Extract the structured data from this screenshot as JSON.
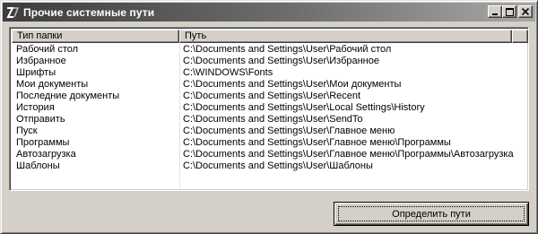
{
  "window": {
    "title": "Прочие системные пути",
    "icon": "app-icon-z",
    "buttons": [
      "minimize",
      "maximize",
      "close"
    ]
  },
  "list": {
    "columns": [
      "Тип папки",
      "Путь"
    ],
    "rows": [
      {
        "type": "Рабочий стол",
        "path": "C:\\Documents and Settings\\User\\Рабочий стол"
      },
      {
        "type": "Избранное",
        "path": "C:\\Documents and Settings\\User\\Избранное"
      },
      {
        "type": "Шрифты",
        "path": "C:\\WINDOWS\\Fonts"
      },
      {
        "type": "Мои документы",
        "path": "C:\\Documents and Settings\\User\\Мои документы"
      },
      {
        "type": "Последние документы",
        "path": "C:\\Documents and Settings\\User\\Recent"
      },
      {
        "type": "История",
        "path": "C:\\Documents and Settings\\User\\Local Settings\\History"
      },
      {
        "type": "Отправить",
        "path": "C:\\Documents and Settings\\User\\SendTo"
      },
      {
        "type": "Пуск",
        "path": "C:\\Documents and Settings\\User\\Главное меню"
      },
      {
        "type": "Программы",
        "path": "C:\\Documents and Settings\\User\\Главное меню\\Программы"
      },
      {
        "type": "Автозагрузка",
        "path": "C:\\Documents and Settings\\User\\Главное меню\\Программы\\Автозагрузка"
      },
      {
        "type": "Шаблоны",
        "path": "C:\\Documents and Settings\\User\\Шаблоны"
      }
    ]
  },
  "actions": {
    "detect_label": "Определить пути"
  }
}
